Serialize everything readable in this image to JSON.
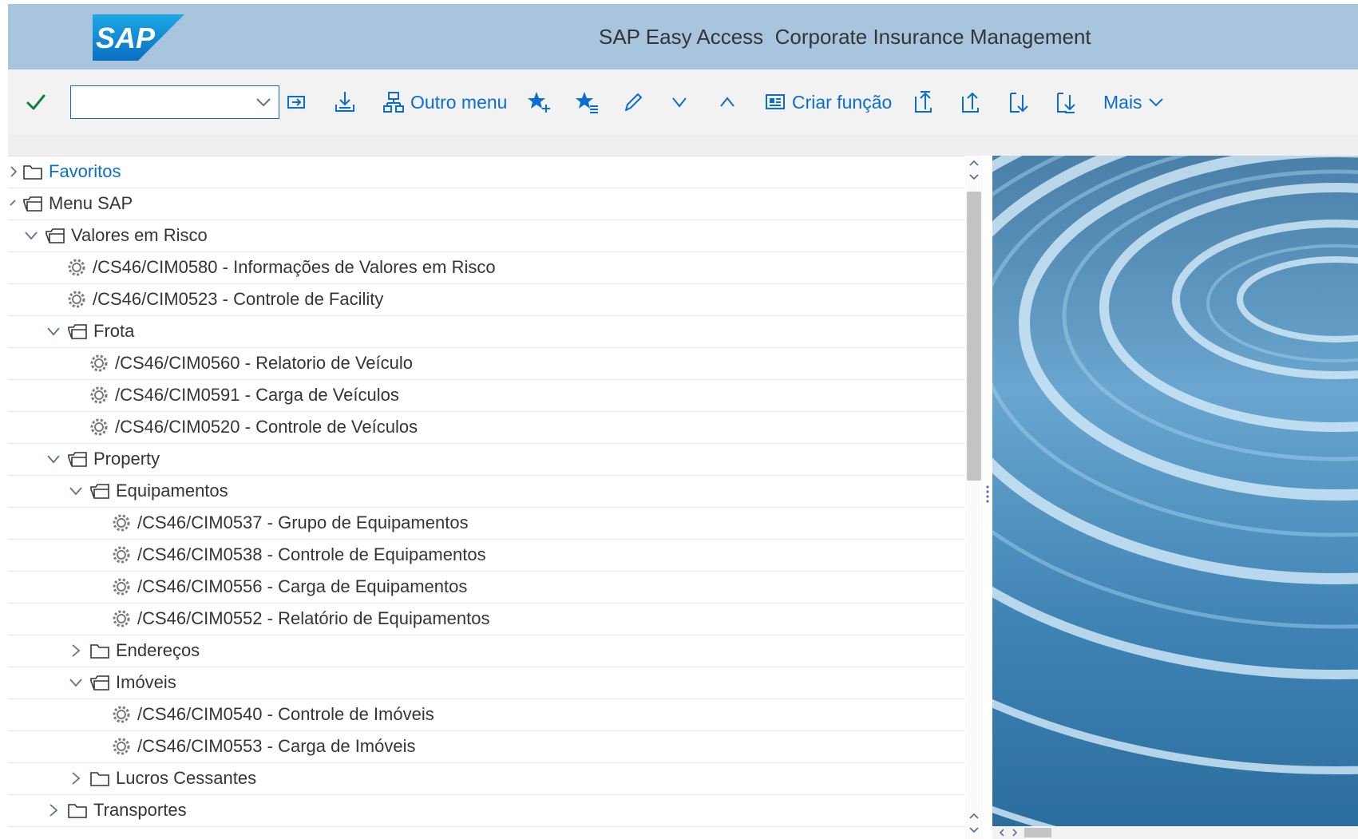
{
  "titlebar": {
    "logo_text": "SAP",
    "title": "SAP Easy Access  Corporate Insurance Management"
  },
  "toolbar": {
    "command_field": {
      "value": "",
      "placeholder": ""
    },
    "other_menu_label": "Outro menu",
    "create_role_label": "Criar função",
    "more_label": "Mais"
  },
  "tree": {
    "favorites": "Favoritos",
    "sap_menu": "Menu SAP",
    "values_at_risk": "Valores em Risco",
    "t0580": "/CS46/CIM0580 - Informações de Valores em Risco",
    "t0523": "/CS46/CIM0523 - Controle de Facility",
    "fleet": "Frota",
    "t0560": "/CS46/CIM0560 - Relatorio de Veículo",
    "t0591": "/CS46/CIM0591 - Carga de Veículos",
    "t0520": "/CS46/CIM0520 - Controle de Veículos",
    "property": "Property",
    "equipment": "Equipamentos",
    "t0537": "/CS46/CIM0537 - Grupo de Equipamentos",
    "t0538": "/CS46/CIM0538 - Controle de Equipamentos",
    "t0556": "/CS46/CIM0556 - Carga de Equipamentos",
    "t0552": "/CS46/CIM0552 - Relatório de Equipamentos",
    "addresses": "Endereços",
    "real_estate": "Imóveis",
    "t0540": "/CS46/CIM0540 - Controle de Imóveis",
    "t0553": "/CS46/CIM0553 - Carga de Imóveis",
    "lost_profits": "Lucros Cessantes",
    "transport": "Transportes"
  },
  "colors": {
    "titlebar_bg": "#a9c4dd",
    "accent": "#0a6ed1",
    "check_green": "#107e3e"
  }
}
